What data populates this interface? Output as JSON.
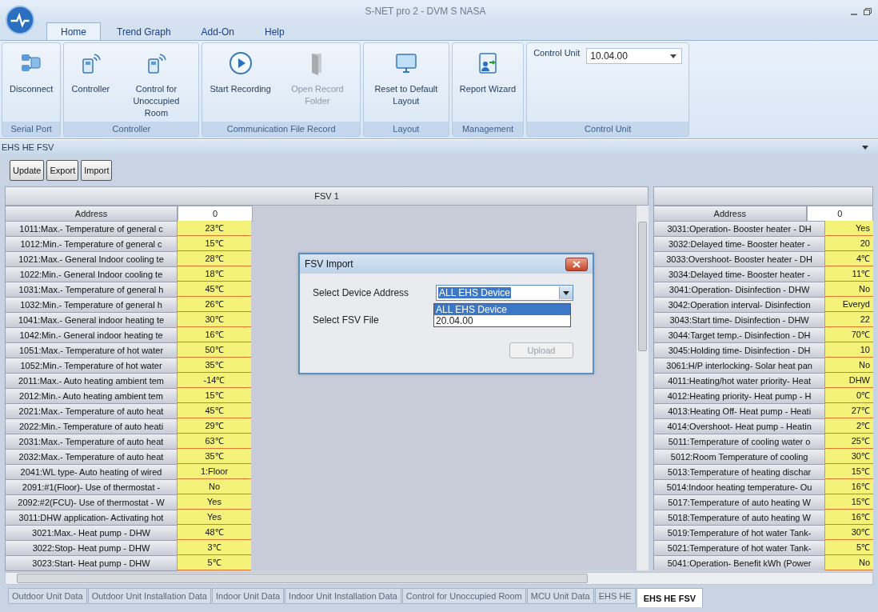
{
  "window": {
    "title": "S-NET pro 2 - DVM S NASA"
  },
  "menu_tabs": [
    {
      "label": "Home",
      "selected": true
    },
    {
      "label": "Trend Graph",
      "selected": false
    },
    {
      "label": "Add-On",
      "selected": false
    },
    {
      "label": "Help",
      "selected": false
    }
  ],
  "ribbon_groups": [
    {
      "label": "Serial Port",
      "buttons": [
        {
          "label": "Disconnect",
          "kind": "plug",
          "disabled": false
        }
      ]
    },
    {
      "label": "Controller",
      "buttons": [
        {
          "label": "Controller",
          "kind": "remote",
          "disabled": false
        },
        {
          "label": "Control for Unoccupied Room",
          "kind": "remote",
          "disabled": false
        }
      ]
    },
    {
      "label": "Communication File Record",
      "buttons": [
        {
          "label": "Start Recording",
          "kind": "play",
          "disabled": false
        },
        {
          "label": "Open Record Folder",
          "kind": "folder",
          "disabled": true
        }
      ]
    },
    {
      "label": "Layout",
      "buttons": [
        {
          "label": "Reset to Default Layout",
          "kind": "monitor",
          "disabled": false
        }
      ]
    },
    {
      "label": "Management",
      "buttons": [
        {
          "label": "Report Wizard",
          "kind": "wizard",
          "disabled": false
        }
      ]
    }
  ],
  "control_unit": {
    "label": "Control Unit",
    "value": "10.04.00",
    "group_label": "Control Unit"
  },
  "panel": {
    "title": "EHS HE FSV",
    "buttons": [
      "Update",
      "Export",
      "Import"
    ]
  },
  "left_table": {
    "title": "FSV 1",
    "columns": [
      "Address",
      "0"
    ],
    "rows": [
      [
        "1011:Max.- Temperature of general c",
        "23℃"
      ],
      [
        "1012:Min.- Temperature of general c",
        "15℃"
      ],
      [
        "1021:Max.- General Indoor cooling te",
        "28℃"
      ],
      [
        "1022:Min.- General Indoor cooling te",
        "18℃"
      ],
      [
        "1031:Max.- Temperature of general h",
        "45℃"
      ],
      [
        "1032:Min.- Temperature of general h",
        "26℃"
      ],
      [
        "1041:Max.- General indoor heating te",
        "30℃"
      ],
      [
        "1042:Min.- General indoor heating te",
        "16℃"
      ],
      [
        "1051:Max.- Temperature of hot water",
        "50℃"
      ],
      [
        "1052:Min.- Temperature of hot water",
        "35℃"
      ],
      [
        "2011:Max.- Auto heating ambient tem",
        "-14℃"
      ],
      [
        "2012:Min.- Auto heating ambient tem",
        "15℃"
      ],
      [
        "2021:Max.- Temperature of auto heat",
        "45℃"
      ],
      [
        "2022:Min.- Temperature of auto heati",
        "29℃"
      ],
      [
        "2031:Max.- Temperature of auto heat",
        "63℃"
      ],
      [
        "2032:Max.- Temperature of auto heat",
        "35℃"
      ],
      [
        "2041:WL type- Auto heating of wired",
        "1:Floor"
      ],
      [
        "2091:#1(Floor)- Use of thermostat -",
        "No"
      ],
      [
        "2092:#2(FCU)- Use of thermostat - W",
        "Yes"
      ],
      [
        "3011:DHW application- Activating hot",
        "Yes"
      ],
      [
        "3021:Max.- Heat pump - DHW",
        "48℃"
      ],
      [
        "3022:Stop- Heat pump - DHW",
        "3℃"
      ],
      [
        "3023:Start- Heat pump - DHW",
        "5℃"
      ]
    ]
  },
  "right_table": {
    "columns": [
      "Address",
      "0"
    ],
    "rows": [
      [
        "3031:Operation- Booster heater - DH",
        "Yes"
      ],
      [
        "3032:Delayed time- Booster heater -",
        "20"
      ],
      [
        "3033:Overshoot- Booster heater - DH",
        "4℃"
      ],
      [
        "3034:Delayed time- Booster heater -",
        "11℃"
      ],
      [
        "3041:Operation- Disinfection - DHW",
        "No"
      ],
      [
        "3042:Operation interval- Disinfection",
        "Everyd"
      ],
      [
        "3043:Start time- Disinfection - DHW",
        "22"
      ],
      [
        "3044:Target temp.- Disinfection - DH",
        "70℃"
      ],
      [
        "3045:Holding time- Disinfection - DH",
        "10"
      ],
      [
        "3061:H/P interlocking- Solar heat pan",
        "No"
      ],
      [
        "4011:Heating/hot water priority- Heat",
        "DHW"
      ],
      [
        "4012:Heating priority- Heat pump - H",
        "0℃"
      ],
      [
        "4013:Heating Off- Heat pump - Heati",
        "27℃"
      ],
      [
        "4014:Overshoot- Heat pump - Heatin",
        "2℃"
      ],
      [
        "5011:Temperature of cooling water o",
        "25℃"
      ],
      [
        "5012:Room Temperature of cooling",
        "30℃"
      ],
      [
        "5013:Temperature of heating dischar",
        "15℃"
      ],
      [
        "5014:Indoor heating temperature- Ou",
        "16℃"
      ],
      [
        "5017:Temperature of auto heating W",
        "15℃"
      ],
      [
        "5018:Temperature of auto heating W",
        "16℃"
      ],
      [
        "5019:Temperature of hot water Tank-",
        "30℃"
      ],
      [
        "5021:Temperature of hot water Tank-",
        "5℃"
      ],
      [
        "5041:Operation- Benefit kWh (Power",
        "No"
      ]
    ]
  },
  "dialog": {
    "title": "FSV Import",
    "device_label": "Select Device Address",
    "device_value": "ALL EHS Device",
    "options": [
      {
        "label": "ALL EHS Device",
        "selected": true
      },
      {
        "label": "20.04.00",
        "selected": false
      }
    ],
    "file_label": "Select FSV File",
    "upload": {
      "label": "Upload",
      "disabled": true
    }
  },
  "bottom_tabs": [
    {
      "label": "Outdoor Unit Data",
      "selected": false
    },
    {
      "label": "Outdoor Unit Installation Data",
      "selected": false
    },
    {
      "label": "Indoor Unit Data",
      "selected": false
    },
    {
      "label": "Indoor Unit Installation Data",
      "selected": false
    },
    {
      "label": "Control for Unoccupied Room",
      "selected": false
    },
    {
      "label": "MCU Unit Data",
      "selected": false
    },
    {
      "label": "EHS HE",
      "selected": false
    },
    {
      "label": "EHS HE FSV",
      "selected": true
    }
  ]
}
